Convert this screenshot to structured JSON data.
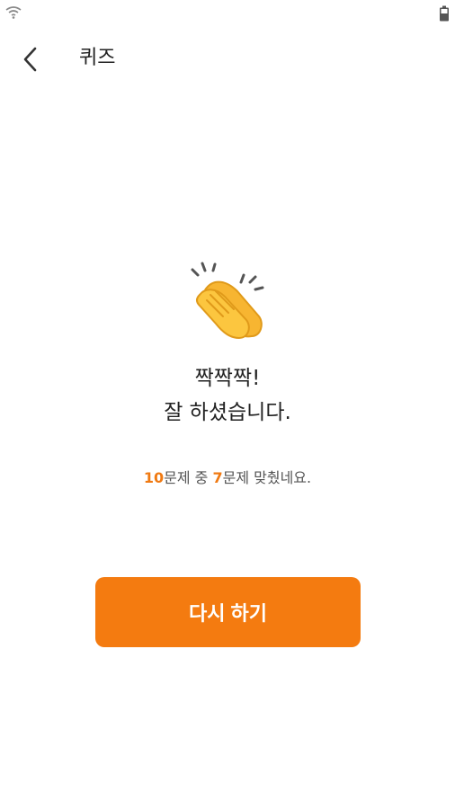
{
  "status_bar": {
    "left_icon": "wifi-icon",
    "right_icon": "battery-icon"
  },
  "header": {
    "back_icon": "chevron-left-icon",
    "title": "퀴즈"
  },
  "result": {
    "icon": "clapping-hands-icon",
    "headline_line1": "짝짝짝!",
    "headline_line2": "잘 하셨습니다.",
    "total": "10",
    "total_suffix": "문제 중 ",
    "correct": "7",
    "correct_suffix": "문제 맞췄네요."
  },
  "actions": {
    "retry_label": "다시 하기"
  },
  "colors": {
    "accent": "#f47b10",
    "highlight_number": "#f07a12",
    "text": "#222222"
  }
}
